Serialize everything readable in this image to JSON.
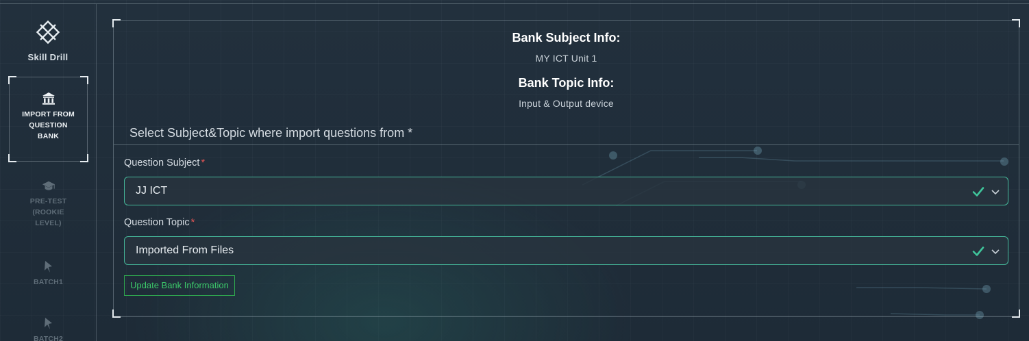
{
  "sidebar": {
    "brand": {
      "label": "Skill Drill",
      "icon": "diamond-grid-icon"
    },
    "items": [
      {
        "label": "IMPORT FROM QUESTION BANK",
        "icon": "bank-icon",
        "active": true
      },
      {
        "label": "PRE-TEST (ROOKIE LEVEL)",
        "icon": "graduation-cap-icon",
        "active": false
      },
      {
        "label": "BATCH1",
        "icon": "pin-icon",
        "active": false
      },
      {
        "label": "BATCH2",
        "icon": "pin-icon",
        "active": false
      }
    ]
  },
  "main": {
    "subject_info_title": "Bank Subject Info:",
    "subject_info_value": "MY ICT Unit 1",
    "topic_info_title": "Bank Topic Info:",
    "topic_info_value": "Input & Output device",
    "section_heading": "Select Subject&Topic where import questions from *",
    "subject_field": {
      "label": "Question Subject",
      "required_mark": "*",
      "value": "JJ ICT"
    },
    "topic_field": {
      "label": "Question Topic",
      "required_mark": "*",
      "value": "Imported From Files"
    },
    "update_button": "Update Bank Information"
  },
  "colors": {
    "accent": "#45b89a",
    "check": "#3fc59b",
    "button": "#3cc96a",
    "required": "#e05555"
  }
}
